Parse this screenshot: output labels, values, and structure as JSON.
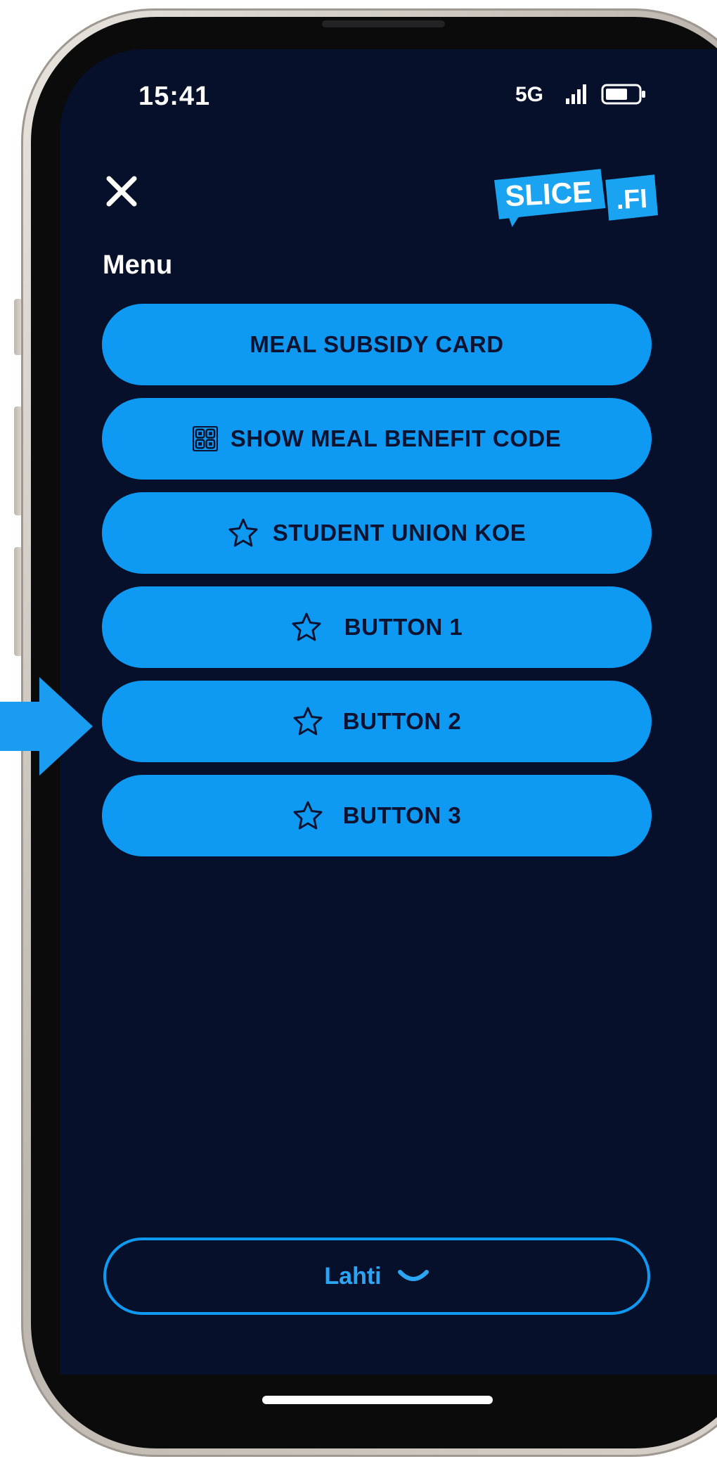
{
  "status_bar": {
    "time": "15:41",
    "network": "5G"
  },
  "header": {
    "close_icon": "close-icon",
    "logo": {
      "main_text": "SLICE",
      "suffix_text": ".FI",
      "color": "#1aa3f0"
    }
  },
  "menu": {
    "title": "Menu",
    "items": [
      {
        "label": "MEAL SUBSIDY CARD",
        "icon": ""
      },
      {
        "label": "SHOW MEAL BENEFIT CODE",
        "icon": "qr-code-icon"
      },
      {
        "label": "STUDENT UNION KOE",
        "icon": "star-icon"
      },
      {
        "label": "BUTTON 1",
        "icon": "star-icon"
      },
      {
        "label": "BUTTON 2",
        "icon": "star-icon"
      },
      {
        "label": "BUTTON 3",
        "icon": "star-icon"
      }
    ]
  },
  "city_selector": {
    "value": "Lahti",
    "icon": "chevron-down-icon"
  },
  "annotation": {
    "icon": "arrow-right-icon",
    "target": "BUTTON 2"
  },
  "colors": {
    "background": "#06102a",
    "button": "#0e99f2",
    "button_text": "#0b1330",
    "outline": "#0e99f2",
    "arrow": "#1a9cf0"
  }
}
